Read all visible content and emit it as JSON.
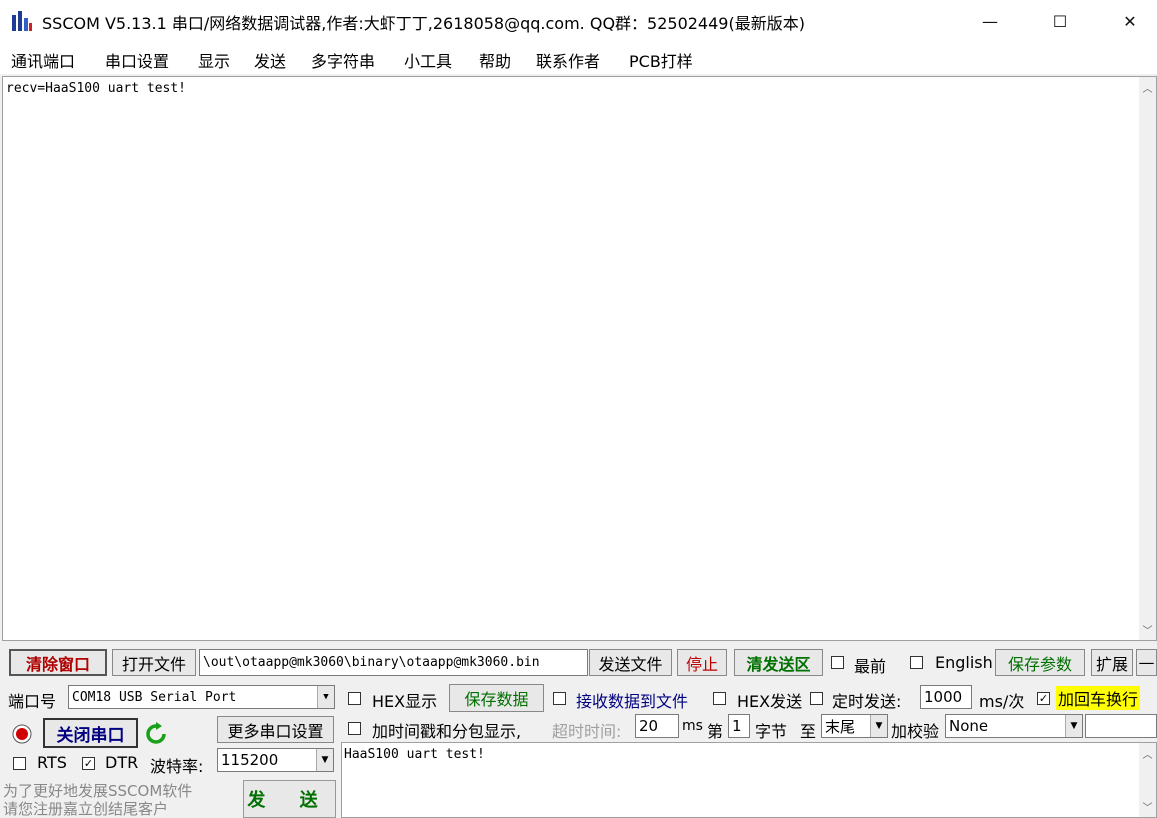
{
  "window": {
    "title": "SSCOM V5.13.1 串口/网络数据调试器,作者:大虾丁丁,2618058@qq.com. QQ群：52502449(最新版本)",
    "minimize": "—",
    "maximize": "☐",
    "close": "✕"
  },
  "menu": [
    "通讯端口",
    "串口设置",
    "显示",
    "发送",
    "多字符串",
    "小工具",
    "帮助",
    "联系作者",
    "PCB打样"
  ],
  "receive": {
    "text": "recv=HaaS100 uart test!"
  },
  "toolbar": {
    "clear_window": "清除窗口",
    "open_file": "打开文件",
    "file_path": "\\out\\otaapp@mk3060\\binary\\otaapp@mk3060.bin",
    "send_file": "发送文件",
    "stop": "停止",
    "clear_send": "清发送区",
    "topmost": "最前",
    "english": "English",
    "save_params": "保存参数",
    "expand": "扩展",
    "dash": "—"
  },
  "port": {
    "label": "端口号",
    "value": "COM18 USB Serial Port",
    "close_port": "关闭串口",
    "more_settings": "更多串口设置",
    "rts": "RTS",
    "dtr": "DTR",
    "baud_label": "波特率:",
    "baud_value": "115200"
  },
  "options": {
    "hex_display": "HEX显示",
    "save_data": "保存数据",
    "recv_to_file": "接收数据到文件",
    "hex_send": "HEX发送",
    "timed_send": "定时发送:",
    "interval": "1000",
    "interval_unit": "ms/次",
    "add_crlf": "加回车换行",
    "timestamp": "加时间戳和分包显示,",
    "timeout_label": "超时时间:",
    "timeout_value": "20",
    "ms": "ms",
    "byte_no": "第",
    "byte_index": "1",
    "byte_unit": "字节",
    "to": "至",
    "end_value": "末尾",
    "checksum_label": "加校验",
    "checksum_value": "None"
  },
  "send": {
    "text": "HaaS100 uart test!",
    "button": "发 送"
  },
  "promo": {
    "line1": "为了更好地发展SSCOM软件",
    "line2": "请您注册嘉立创结尾客户"
  }
}
